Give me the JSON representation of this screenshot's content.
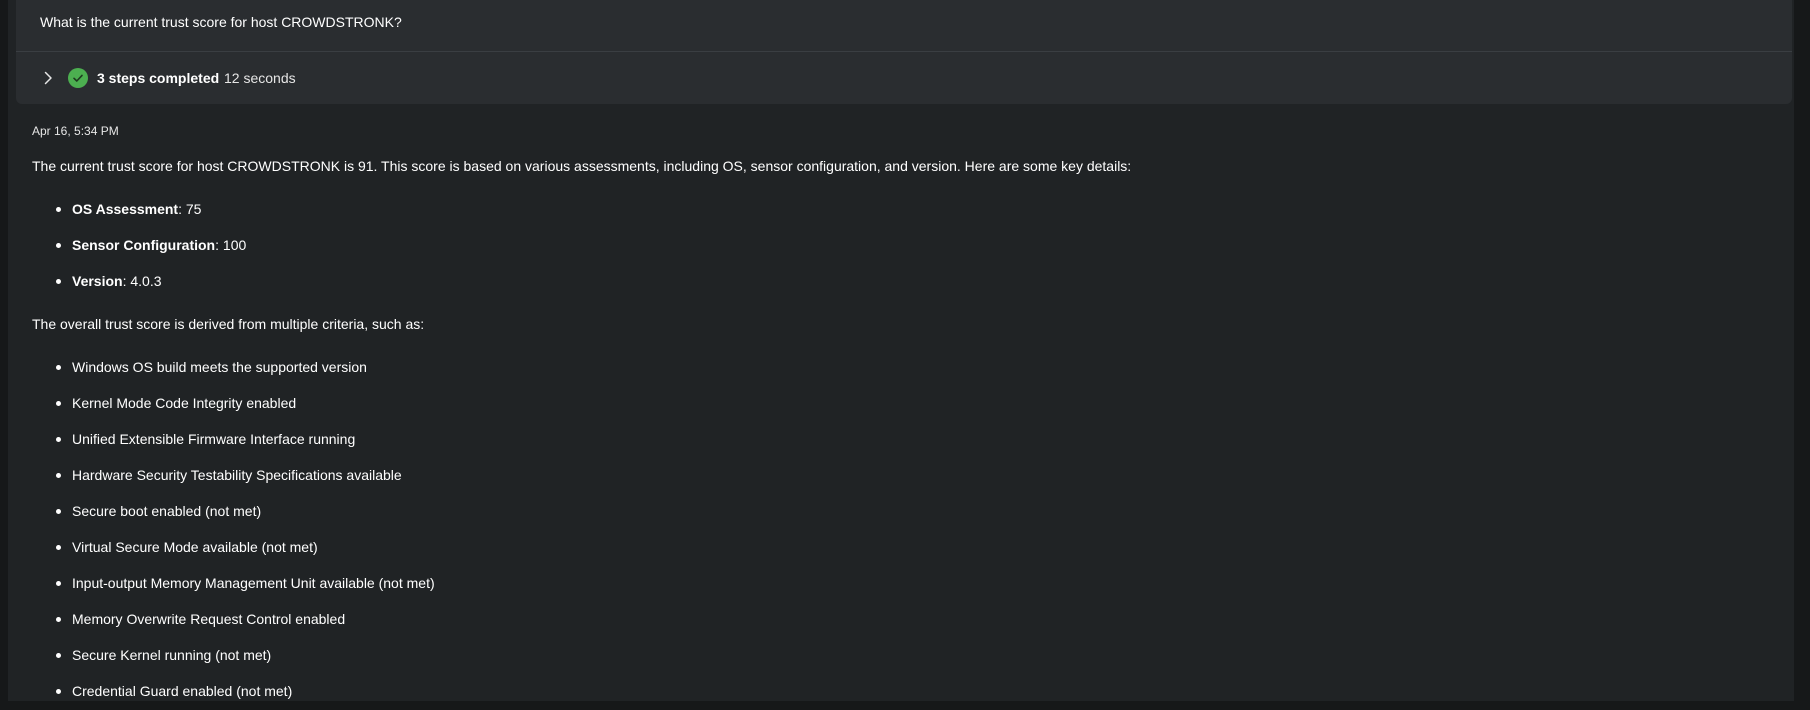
{
  "query": {
    "question": "What is the current trust score for host CROWDSTRONK?"
  },
  "steps": {
    "label": "3 steps completed",
    "duration": "12 seconds",
    "status_color": "#4caf50"
  },
  "response": {
    "timestamp": "Apr 16, 5:34 PM",
    "intro": "The current trust score for host CROWDSTRONK is 91. This score is based on various assessments, including OS, sensor configuration, and version. Here are some key details:",
    "details": [
      {
        "key": "OS Assessment",
        "value": ": 75"
      },
      {
        "key": "Sensor Configuration",
        "value": ": 100"
      },
      {
        "key": "Version",
        "value": ": 4.0.3"
      }
    ],
    "criteria_intro": "The overall trust score is derived from multiple criteria, such as:",
    "criteria": [
      "Windows OS build meets the supported version",
      "Kernel Mode Code Integrity enabled",
      "Unified Extensible Firmware Interface running",
      "Hardware Security Testability Specifications available",
      "Secure boot enabled (not met)",
      "Virtual Secure Mode available (not met)",
      "Input-output Memory Management Unit available (not met)",
      "Memory Overwrite Request Control enabled",
      "Secure Kernel running (not met)",
      "Credential Guard enabled (not met)"
    ]
  },
  "icons": {
    "expand": "chevron-right-icon",
    "status": "check-circle-icon"
  }
}
